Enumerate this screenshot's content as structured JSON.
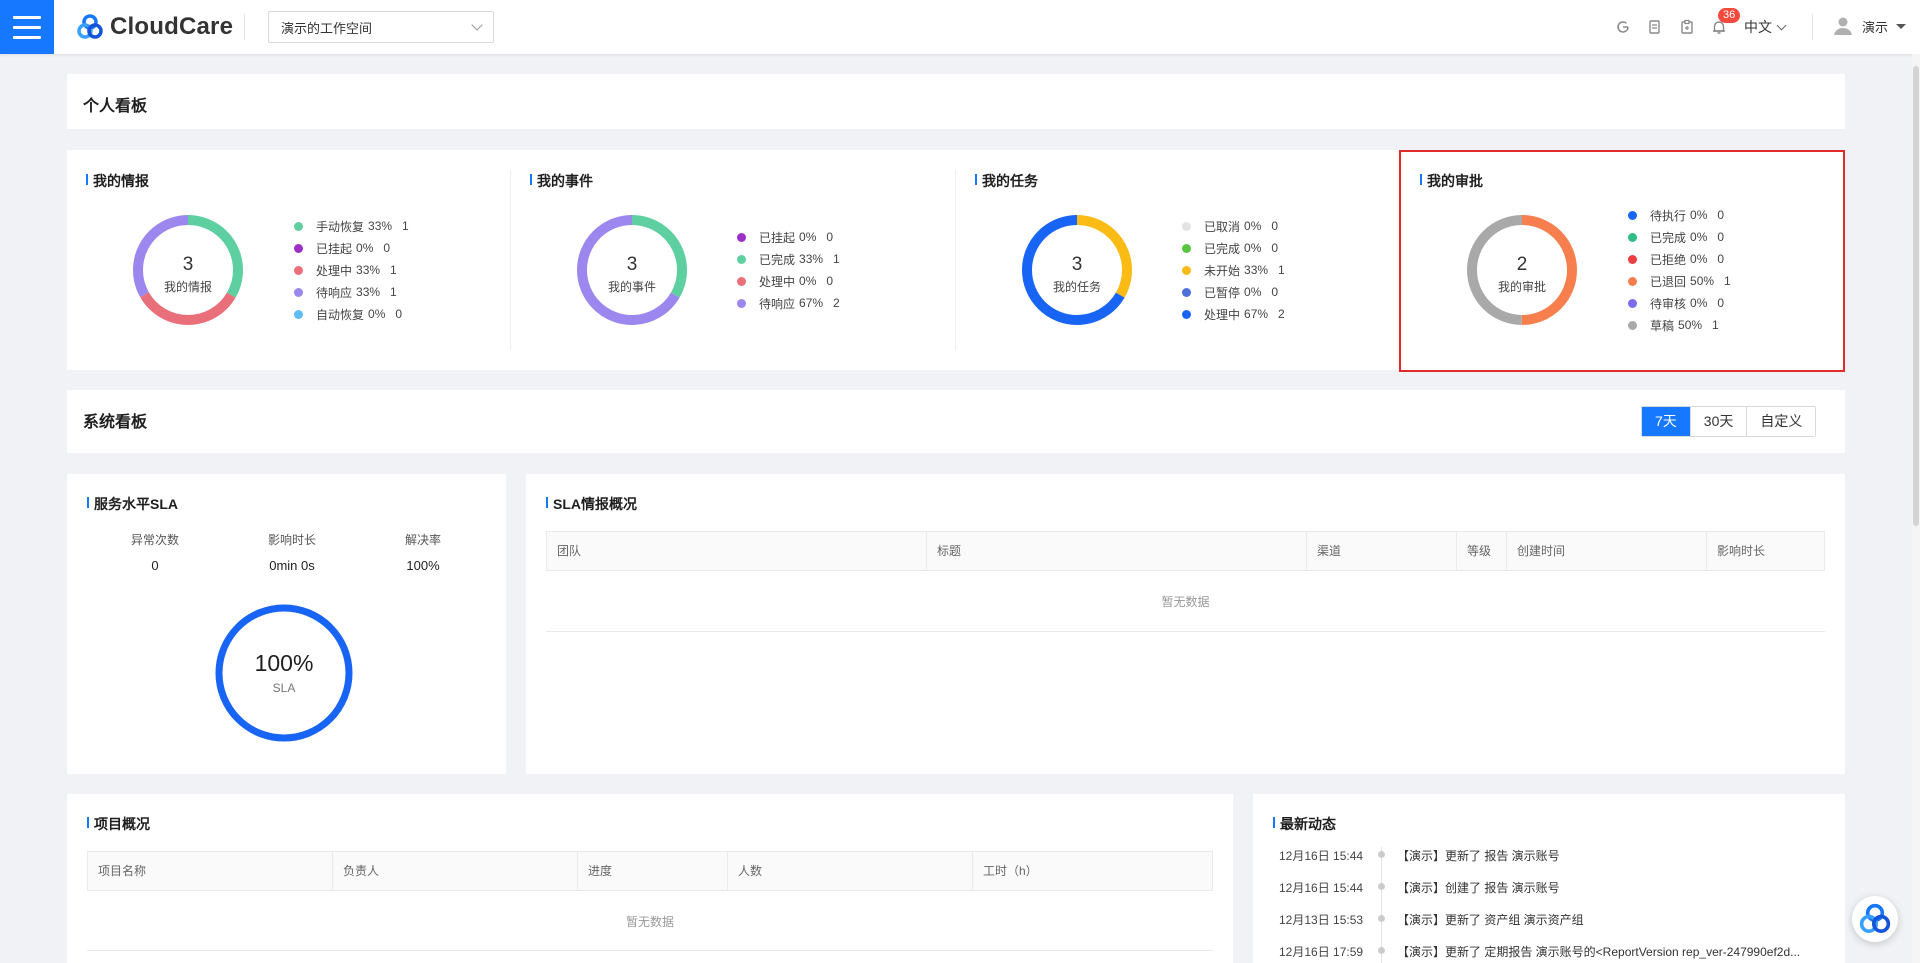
{
  "header": {
    "logo_text": "CloudCare",
    "workspace": "演示的工作空间",
    "notification_count": "36",
    "language": "中文",
    "user_name": "演示"
  },
  "personal_board": {
    "title": "个人看板",
    "panels": [
      {
        "title": "我的情报",
        "center_value": "3",
        "center_label": "我的情报",
        "items": [
          {
            "name": "手动恢复",
            "pct": "33%",
            "count": "1",
            "color": "#5ecfa0"
          },
          {
            "name": "已挂起",
            "pct": "0%",
            "count": "0",
            "color": "#9c2fc6"
          },
          {
            "name": "处理中",
            "pct": "33%",
            "count": "1",
            "color": "#e9707a"
          },
          {
            "name": "待响应",
            "pct": "33%",
            "count": "1",
            "color": "#9b87ee"
          },
          {
            "name": "自动恢复",
            "pct": "0%",
            "count": "0",
            "color": "#5cbdf6"
          }
        ]
      },
      {
        "title": "我的事件",
        "center_value": "3",
        "center_label": "我的事件",
        "items": [
          {
            "name": "已挂起",
            "pct": "0%",
            "count": "0",
            "color": "#9c2fc6"
          },
          {
            "name": "已完成",
            "pct": "33%",
            "count": "1",
            "color": "#5ecfa0"
          },
          {
            "name": "处理中",
            "pct": "0%",
            "count": "0",
            "color": "#e9707a"
          },
          {
            "name": "待响应",
            "pct": "67%",
            "count": "2",
            "color": "#9b87ee"
          }
        ]
      },
      {
        "title": "我的任务",
        "center_value": "3",
        "center_label": "我的任务",
        "items": [
          {
            "name": "已取消",
            "pct": "0%",
            "count": "0",
            "color": "#e3e3e3"
          },
          {
            "name": "已完成",
            "pct": "0%",
            "count": "0",
            "color": "#58c43f"
          },
          {
            "name": "未开始",
            "pct": "33%",
            "count": "1",
            "color": "#fbbb15"
          },
          {
            "name": "已暂停",
            "pct": "0%",
            "count": "0",
            "color": "#4e72d9"
          },
          {
            "name": "处理中",
            "pct": "67%",
            "count": "2",
            "color": "#1764f5"
          }
        ]
      },
      {
        "title": "我的审批",
        "center_value": "2",
        "center_label": "我的审批",
        "items": [
          {
            "name": "待执行",
            "pct": "0%",
            "count": "0",
            "color": "#1764f5"
          },
          {
            "name": "已完成",
            "pct": "0%",
            "count": "0",
            "color": "#2fbd86"
          },
          {
            "name": "已拒绝",
            "pct": "0%",
            "count": "0",
            "color": "#ec3e3e"
          },
          {
            "name": "已退回",
            "pct": "50%",
            "count": "1",
            "color": "#f77e4d"
          },
          {
            "name": "待审核",
            "pct": "0%",
            "count": "0",
            "color": "#7a6cf0"
          },
          {
            "name": "草稿",
            "pct": "50%",
            "count": "1",
            "color": "#a9a9a9"
          }
        ]
      }
    ]
  },
  "system_board": {
    "title": "系统看板",
    "ranges": [
      "7天",
      "30天",
      "自定义"
    ],
    "active_range": "7天"
  },
  "sla": {
    "title": "服务水平SLA",
    "metrics": [
      {
        "label": "异常次数",
        "value": "0"
      },
      {
        "label": "影响时长",
        "value": "0min 0s"
      },
      {
        "label": "解决率",
        "value": "100%"
      }
    ],
    "gauge_value": "100%",
    "gauge_label": "SLA",
    "gauge_fraction": 1.0,
    "accent": "#1764f5"
  },
  "sla_overview": {
    "title": "SLA情报概况",
    "columns": [
      "团队",
      "标题",
      "渠道",
      "等级",
      "创建时间",
      "影响时长"
    ],
    "empty_text": "暂无数据"
  },
  "projects": {
    "title": "项目概况",
    "columns": [
      "项目名称",
      "负责人",
      "进度",
      "人数",
      "工时（h）"
    ],
    "empty_text": "暂无数据"
  },
  "activity": {
    "title": "最新动态",
    "items": [
      {
        "time": "12月16日 15:44",
        "text": "【演示】更新了 报告 演示账号"
      },
      {
        "time": "12月16日 15:44",
        "text": "【演示】创建了 报告 演示账号"
      },
      {
        "time": "12月13日 15:53",
        "text": "【演示】更新了 资产组 演示资产组"
      },
      {
        "time": "12月16日 17:59",
        "text": "【演示】更新了 定期报告 演示账号的<ReportVersion rep_ver-247990ef2d..."
      }
    ]
  }
}
